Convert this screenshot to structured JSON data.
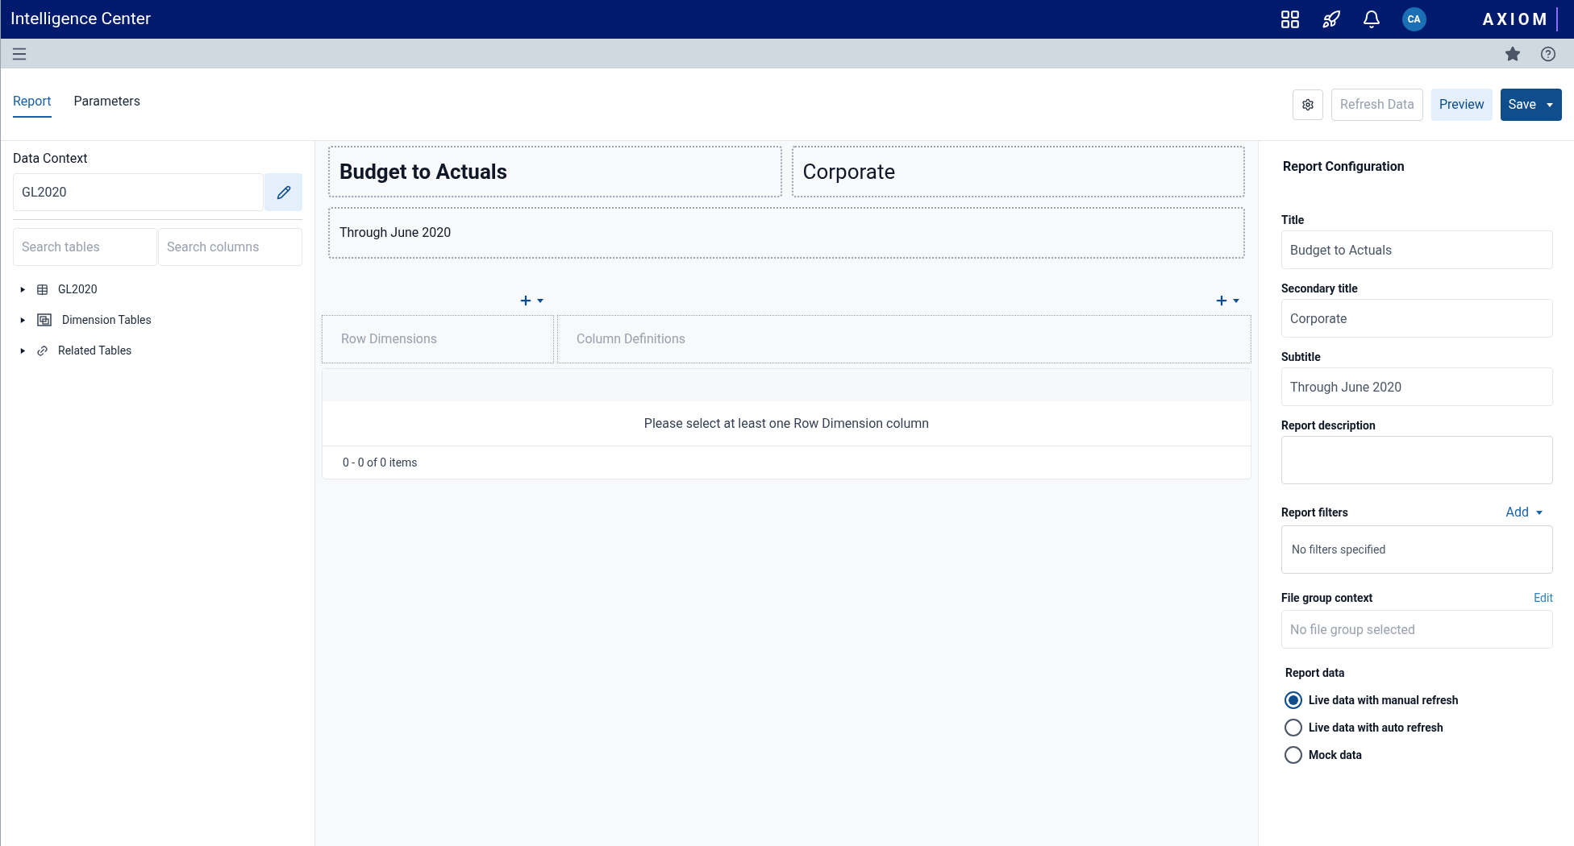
{
  "app_bar": {
    "title": "Intelligence Center",
    "avatar": "CA",
    "logo": "AXIOM"
  },
  "tabs": [
    {
      "label": "Report",
      "selected": true
    },
    {
      "label": "Parameters",
      "selected": false
    }
  ],
  "toolbar": {
    "buttons": [
      {
        "label": "Refresh Data",
        "kind": "outline",
        "disabled": true
      },
      {
        "label": "Preview",
        "kind": "light",
        "disabled": false
      },
      {
        "label": "Save",
        "kind": "primary",
        "disabled": false
      }
    ]
  },
  "data_context": {
    "label": "Data Context",
    "value": "GL2020",
    "search_tables": {
      "placeholder": "Search tables"
    },
    "search_columns": {
      "placeholder": "Search columns"
    },
    "tree": [
      {
        "label": "GL2020",
        "kind": "table",
        "expanded": false
      },
      {
        "label": "Dimension Tables",
        "kind": "dimension",
        "expanded": false
      },
      {
        "label": "Related Tables",
        "kind": "related",
        "expanded": false
      }
    ]
  },
  "canvas": {
    "title": "Budget to Actuals",
    "secondary_title": "Corporate",
    "subtitle": "Through June 2020",
    "row_dimensions": "Row Dimensions",
    "column_definitions": "Column Definitions",
    "empty_message": "Please select at least one Row Dimension column",
    "pager": "0 - 0 of 0 items"
  },
  "config": {
    "heading": "Report Configuration",
    "fields": [
      {
        "label": "Title",
        "value": "Budget to Actuals"
      },
      {
        "label": "Secondary title",
        "value": "Corporate"
      },
      {
        "label": "Subtitle",
        "value": "Through June 2020"
      }
    ],
    "description": {
      "label": "Report description"
    },
    "filters": {
      "label": "Report filters",
      "action": "Add",
      "empty": "No filters specified"
    },
    "file_group": {
      "label": "File group context",
      "action": "Edit",
      "placeholder": "No file group selected"
    },
    "report_data": {
      "label": "Report data",
      "options": [
        {
          "label": "Live data with manual refresh",
          "selected": true
        },
        {
          "label": "Live data with auto refresh",
          "selected": false
        },
        {
          "label": "Mock data",
          "selected": false
        }
      ]
    }
  }
}
